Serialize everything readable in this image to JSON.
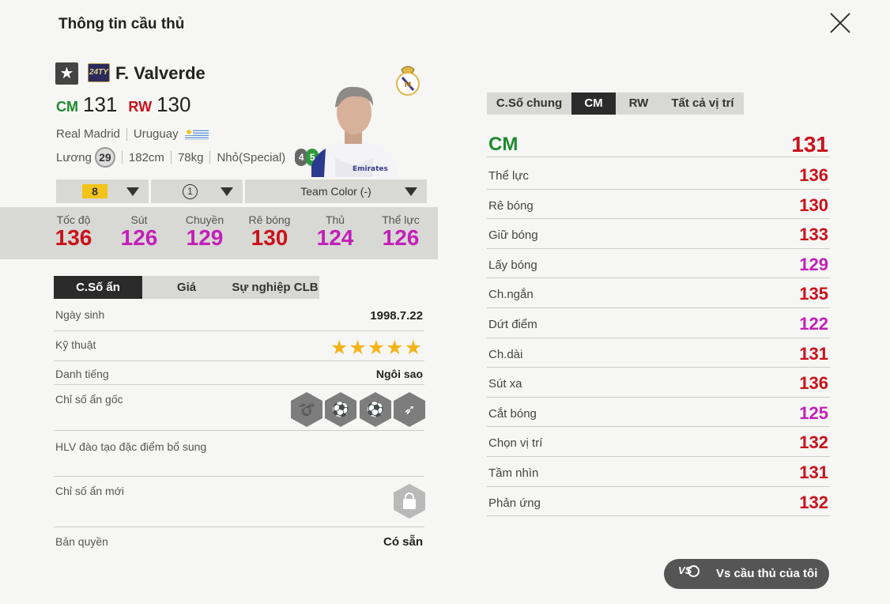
{
  "header": {
    "title": "Thông tin cầu thủ"
  },
  "player": {
    "season": "24TY",
    "name": "F. Valverde",
    "positions": [
      {
        "pos": "CM",
        "ovr": "131"
      },
      {
        "pos": "RW",
        "ovr": "130"
      }
    ],
    "club": "Real Madrid",
    "nation": "Uruguay",
    "salary_label": "Lương",
    "salary": "29",
    "height": "182cm",
    "weight": "78kg",
    "body_type": "Nhỏ(Special)",
    "weak_foot": "4",
    "strong_foot": "5"
  },
  "selectors": {
    "upgrade_level": "8",
    "team_level": "1",
    "team_color": "Team Color (-)"
  },
  "summary_stats": [
    {
      "label": "Tốc độ",
      "value": "136",
      "color": "#c9121b"
    },
    {
      "label": "Sút",
      "value": "126",
      "color": "#c31fb8"
    },
    {
      "label": "Chuyền",
      "value": "129",
      "color": "#c31fb8"
    },
    {
      "label": "Rê bóng",
      "value": "130",
      "color": "#c9121b"
    },
    {
      "label": "Thủ",
      "value": "124",
      "color": "#c31fb8"
    },
    {
      "label": "Thể lực",
      "value": "126",
      "color": "#c31fb8"
    }
  ],
  "left_tabs": [
    "C.Số ẩn",
    "Giá",
    "Sự nghiệp CLB"
  ],
  "details": {
    "birth_label": "Ngày sinh",
    "birth": "1998.7.22",
    "skill_label": "Kỹ thuật",
    "skill_stars": "★★★★★",
    "reputation_label": "Danh tiếng",
    "reputation": "Ngôi sao",
    "base_traits_label": "Chỉ số ẩn gốc",
    "coach_traits_label": "HLV đào tạo đặc điểm bổ sung",
    "new_traits_label": "Chỉ số ẩn mới",
    "license_label": "Bản quyền",
    "license": "Có sẵn"
  },
  "right_tabs": [
    "C.Số chung",
    "CM",
    "RW",
    "Tất cả vị trí"
  ],
  "position_stats": {
    "position": "CM",
    "overall": "131",
    "rows": [
      {
        "label": "Thể lực",
        "value": "136",
        "color": "#c9121b"
      },
      {
        "label": "Rê bóng",
        "value": "130",
        "color": "#c9121b"
      },
      {
        "label": "Giữ bóng",
        "value": "133",
        "color": "#c9121b"
      },
      {
        "label": "Lấy bóng",
        "value": "129",
        "color": "#c31fb8"
      },
      {
        "label": "Ch.ngắn",
        "value": "135",
        "color": "#c9121b"
      },
      {
        "label": "Dứt điểm",
        "value": "122",
        "color": "#c31fb8"
      },
      {
        "label": "Ch.dài",
        "value": "131",
        "color": "#c9121b"
      },
      {
        "label": "Sút xa",
        "value": "136",
        "color": "#c9121b"
      },
      {
        "label": "Cắt bóng",
        "value": "125",
        "color": "#c31fb8"
      },
      {
        "label": "Chọn vị trí",
        "value": "132",
        "color": "#c9121b"
      },
      {
        "label": "Tầm nhìn",
        "value": "131",
        "color": "#c9121b"
      },
      {
        "label": "Phản ứng",
        "value": "132",
        "color": "#c9121b"
      }
    ]
  },
  "vs_button": {
    "icon_text": "VS",
    "label": "Vs cầu thủ của tôi"
  }
}
